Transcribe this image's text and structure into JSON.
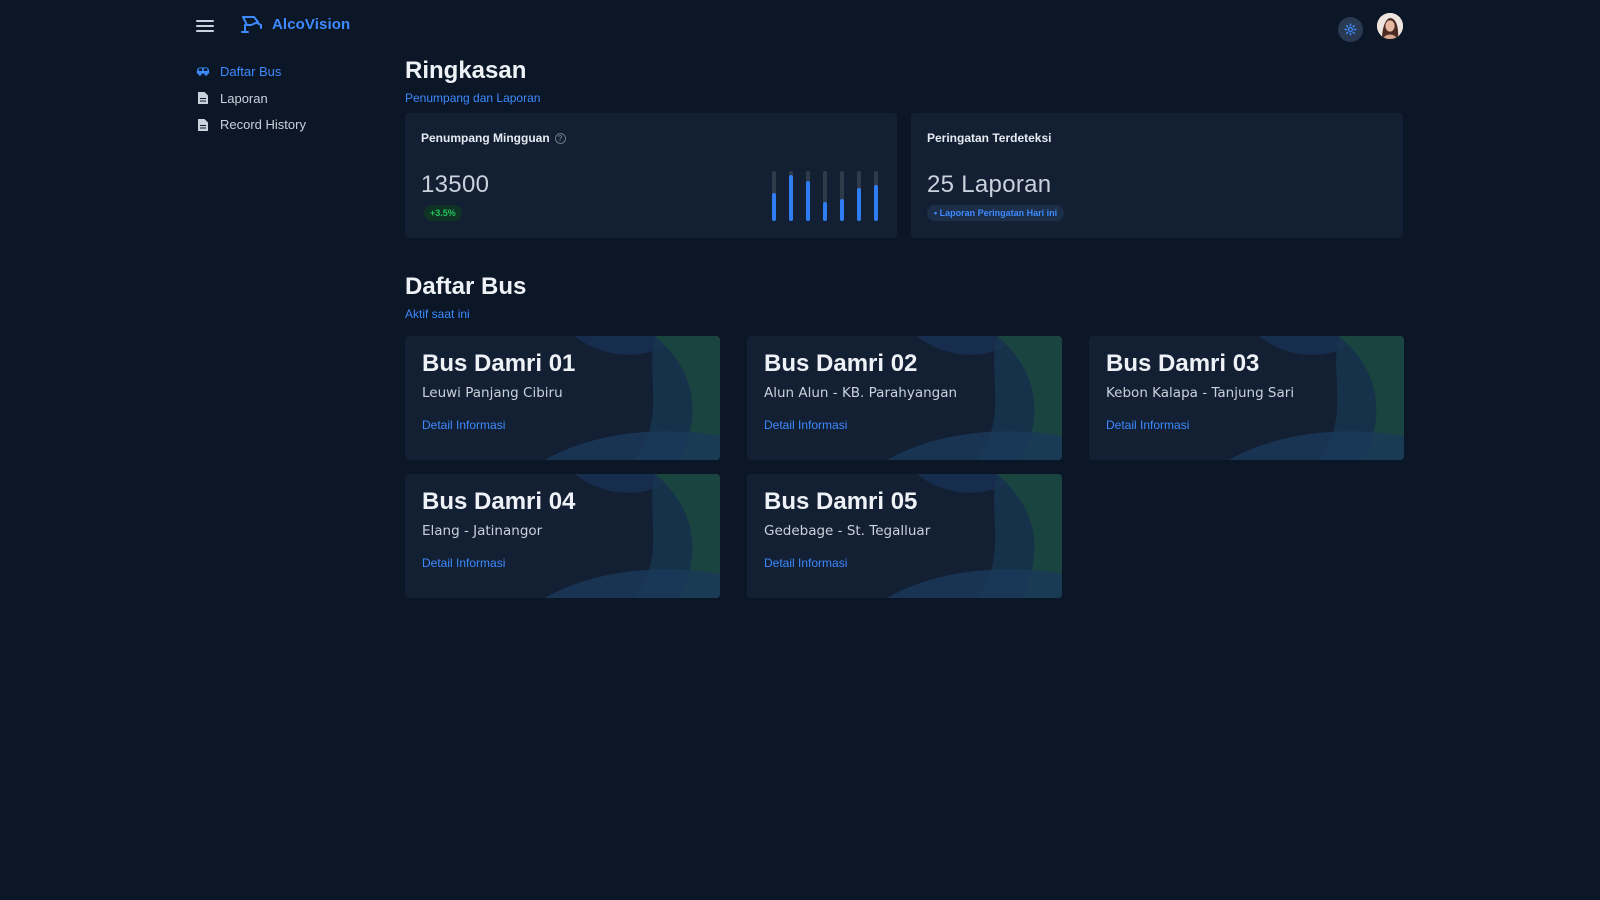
{
  "header": {
    "brand": "AlcoVision",
    "brand_color": "#3d8bff",
    "menu_icon": "hamburger-icon",
    "settings_icon": "gear-icon"
  },
  "sidebar": {
    "items": [
      {
        "label": "Daftar Bus",
        "icon": "bus-icon",
        "active": true
      },
      {
        "label": "Laporan",
        "icon": "document-icon",
        "active": false
      },
      {
        "label": "Record History",
        "icon": "document-icon",
        "active": false
      }
    ]
  },
  "summary": {
    "title": "Ringkasan",
    "subtitle": "Penumpang dan Laporan",
    "weekly_passengers": {
      "label": "Penumpang Mingguan",
      "value": "13500",
      "trend": "+3.5%",
      "bar_levels": [
        0.56,
        0.92,
        0.8,
        0.38,
        0.44,
        0.66,
        0.72
      ]
    },
    "alerts": {
      "label": "Peringatan Terdeteksi",
      "value": "25 Laporan",
      "badge": "• Laporan Peringatan Hari ini"
    }
  },
  "buses": {
    "title": "Daftar Bus",
    "subtitle": "Aktif saat ini",
    "link_label": "Detail Informasi",
    "items": [
      {
        "name": "Bus Damri 01",
        "route": "Leuwi Panjang Cibiru"
      },
      {
        "name": "Bus Damri 02",
        "route": "Alun Alun - KB. Parahyangan"
      },
      {
        "name": "Bus Damri 03",
        "route": "Kebon Kalapa - Tanjung Sari"
      },
      {
        "name": "Bus Damri 04",
        "route": "Elang - Jatinangor"
      },
      {
        "name": "Bus Damri 05",
        "route": "Gedebage - St. Tegalluar"
      }
    ]
  }
}
